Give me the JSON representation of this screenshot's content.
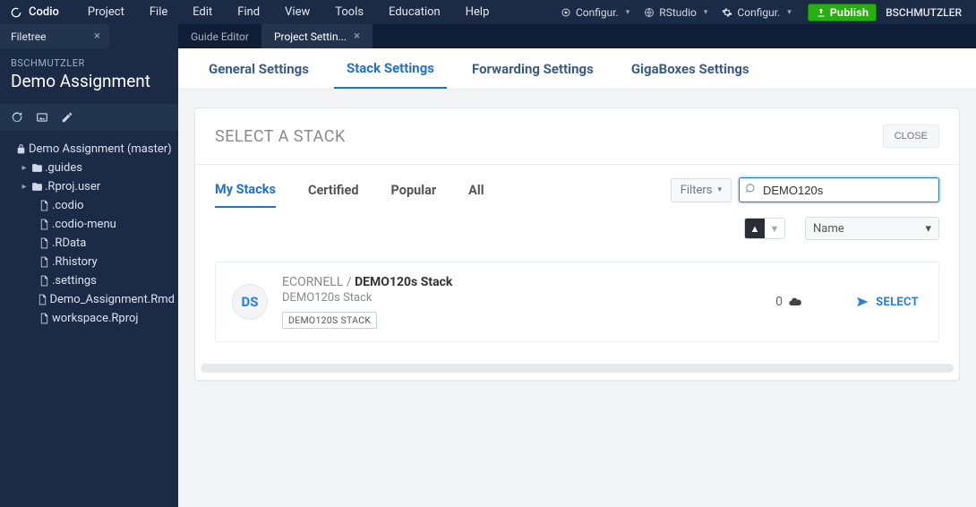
{
  "menubar": {
    "brand": "Codio",
    "items": [
      "Project",
      "File",
      "Edit",
      "Find",
      "View",
      "Tools",
      "Education",
      "Help"
    ],
    "configs": [
      {
        "icon": "target",
        "label": "Configur."
      },
      {
        "icon": "globe",
        "label": "RStudio"
      },
      {
        "icon": "gear",
        "label": "Configur."
      }
    ],
    "publish_label": "Publish",
    "username": "BSCHMUTZLER"
  },
  "tabs": {
    "sidebar_tab": "Filetree",
    "editor_tabs": [
      {
        "label": "Guide Editor",
        "active": false,
        "closable": false
      },
      {
        "label": "Project Settin...",
        "active": true,
        "closable": true
      }
    ]
  },
  "sidebar": {
    "owner": "BSCHMUTZLER",
    "project": "Demo Assignment",
    "tree": [
      {
        "type": "root",
        "name": "Demo Assignment (master)",
        "icon": "lock"
      },
      {
        "type": "folder",
        "name": ".guides",
        "indent": 1
      },
      {
        "type": "folder",
        "name": ".Rproj.user",
        "indent": 1
      },
      {
        "type": "file",
        "name": ".codio",
        "indent": 2
      },
      {
        "type": "file",
        "name": ".codio-menu",
        "indent": 2
      },
      {
        "type": "file",
        "name": ".RData",
        "indent": 2
      },
      {
        "type": "file",
        "name": ".Rhistory",
        "indent": 2
      },
      {
        "type": "file",
        "name": ".settings",
        "indent": 2
      },
      {
        "type": "file",
        "name": "Demo_Assignment.Rmd",
        "indent": 2
      },
      {
        "type": "file",
        "name": "workspace.Rproj",
        "indent": 2
      }
    ]
  },
  "settings": {
    "tabs": [
      "General Settings",
      "Stack Settings",
      "Forwarding Settings",
      "GigaBoxes Settings"
    ],
    "active": "Stack Settings"
  },
  "modal": {
    "title": "SELECT A STACK",
    "close_label": "CLOSE",
    "tabs": [
      "My Stacks",
      "Certified",
      "Popular",
      "All"
    ],
    "active_tab": "My Stacks",
    "filters_label": "Filters",
    "search_value": "DEMO120s",
    "sort_select": "Name",
    "result": {
      "avatar": "DS",
      "owner": "ECORNELL / ",
      "title": "DEMO120s Stack",
      "subtitle": "DEMO120s Stack",
      "tag": "DEMO120S STACK",
      "count": "0",
      "select_label": "SELECT"
    }
  }
}
